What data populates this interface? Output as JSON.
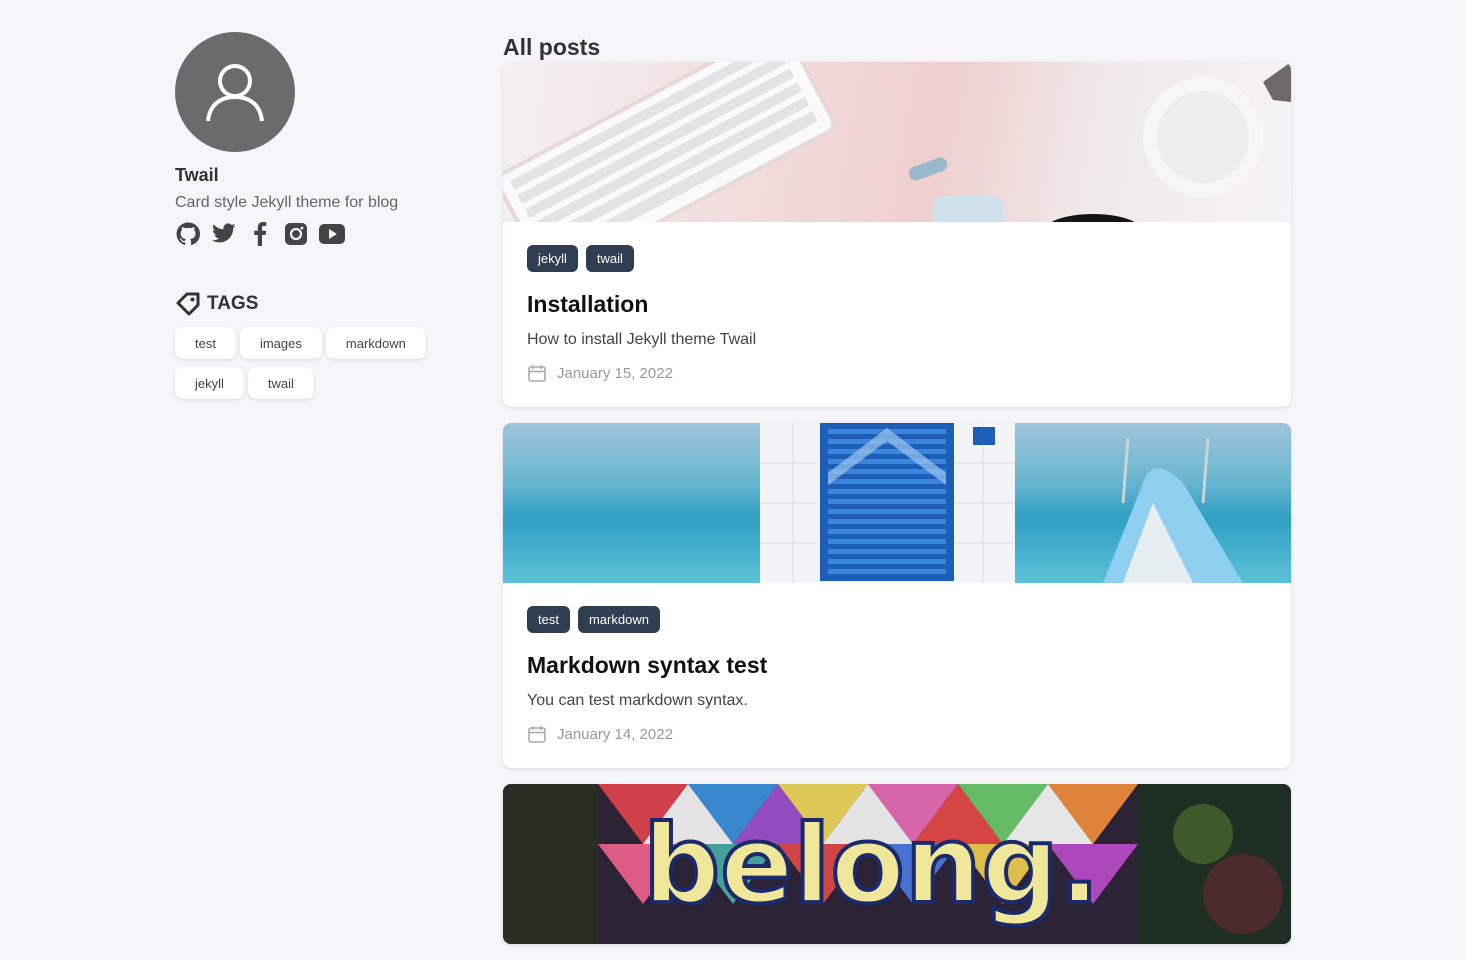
{
  "profile": {
    "name": "Twail",
    "description": "Card style Jekyll theme for blog",
    "socials": [
      {
        "icon": "github-icon"
      },
      {
        "icon": "twitter-icon"
      },
      {
        "icon": "facebook-icon"
      },
      {
        "icon": "instagram-icon"
      },
      {
        "icon": "youtube-icon"
      }
    ]
  },
  "tags_section": {
    "heading": "TAGS",
    "tags": [
      "test",
      "images",
      "markdown",
      "jekyll",
      "twail"
    ]
  },
  "main": {
    "title": "All posts",
    "posts": [
      {
        "tags": [
          "jekyll",
          "twail"
        ],
        "title": "Installation",
        "excerpt": "How to install Jekyll theme Twail",
        "date": "January 15, 2022"
      },
      {
        "tags": [
          "test",
          "markdown"
        ],
        "title": "Markdown syntax test",
        "excerpt": "You can test markdown syntax.",
        "date": "January 14, 2022"
      }
    ],
    "partial_post_image_text": "belong."
  },
  "colors": {
    "background": "#f5f5fa",
    "tag_badge": "#2f3e50",
    "avatar": "#6b6b6b"
  }
}
